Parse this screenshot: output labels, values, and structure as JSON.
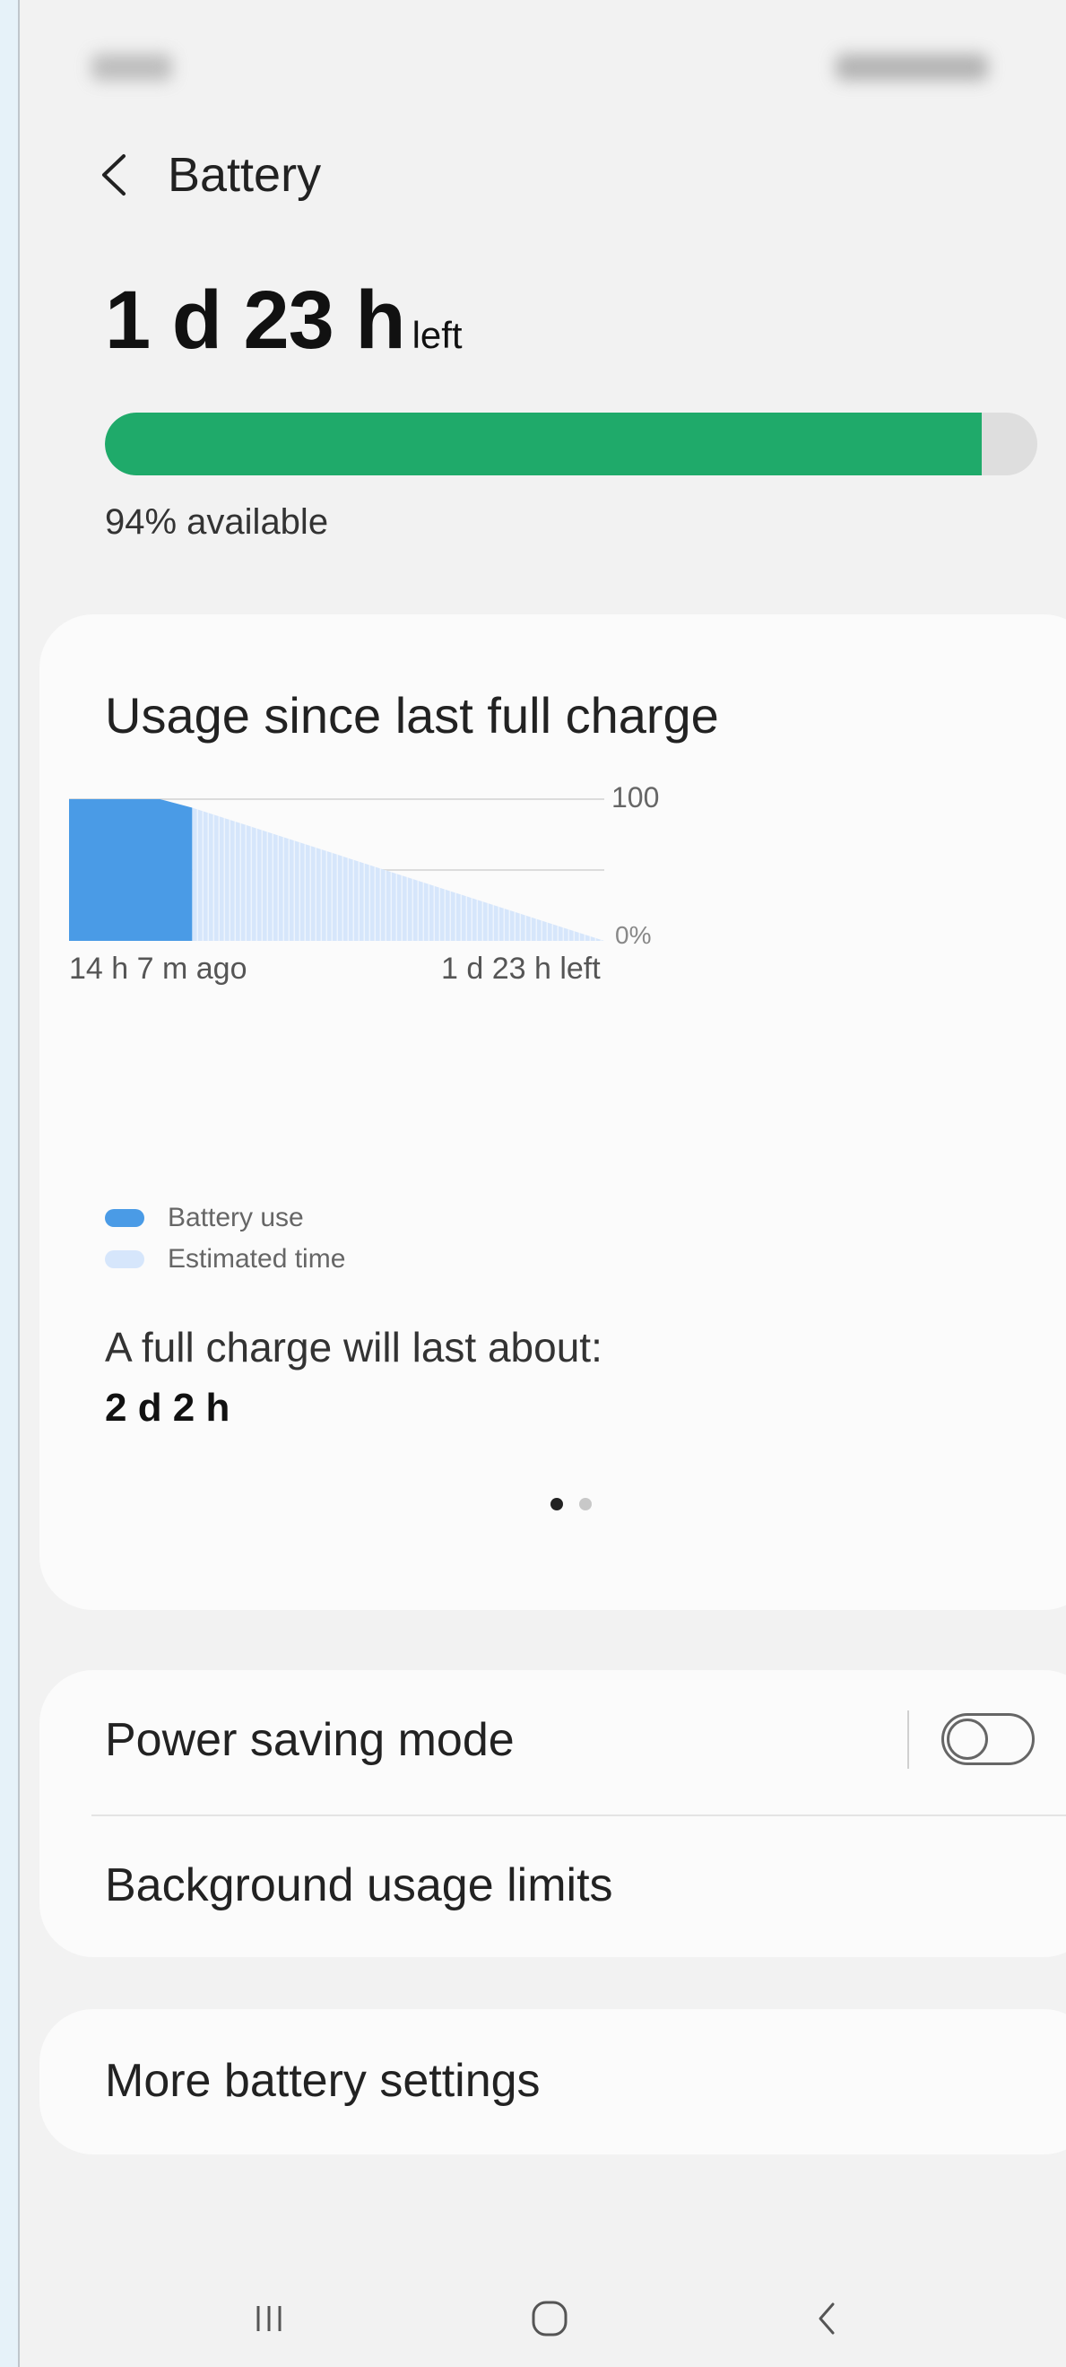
{
  "header": {
    "title": "Battery"
  },
  "battery": {
    "remaining_value": "1 d 23 h",
    "remaining_suffix": "left",
    "percent": 94,
    "available_text": "94% available"
  },
  "usage_card": {
    "title": "Usage since last full charge",
    "full_charge_label": "A full charge will last about:",
    "full_charge_value": "2 d 2 h",
    "legend": [
      {
        "label": "Battery use",
        "color": "#4a9be6"
      },
      {
        "label": "Estimated time",
        "color": "#d6e6fb"
      }
    ],
    "page_dots": {
      "count": 2,
      "active": 0
    }
  },
  "chart_data": {
    "type": "area",
    "x_start_label": "14 h 7 m ago",
    "x_end_label": "1 d 23 h left",
    "y_ticks": [
      "100",
      "0%"
    ],
    "ylim": [
      0,
      100
    ],
    "series": [
      {
        "name": "Battery use",
        "points": [
          [
            0,
            100
          ],
          [
            0.17,
            100
          ],
          [
            0.23,
            94
          ]
        ]
      },
      {
        "name": "Estimated time",
        "points": [
          [
            0.23,
            94
          ],
          [
            1.0,
            0
          ]
        ]
      }
    ],
    "grid": true
  },
  "settings": {
    "power_saving_label": "Power saving mode",
    "power_saving_on": false,
    "background_limits_label": "Background usage limits",
    "more_settings_label": "More battery settings"
  },
  "navbar": {
    "recent_icon": "recent-apps-icon",
    "home_icon": "home-icon",
    "back_icon": "back-icon"
  },
  "colors": {
    "battery_fill": "#1faa6a",
    "battery_use": "#4a9be6",
    "estimated": "#d6e6fb"
  }
}
